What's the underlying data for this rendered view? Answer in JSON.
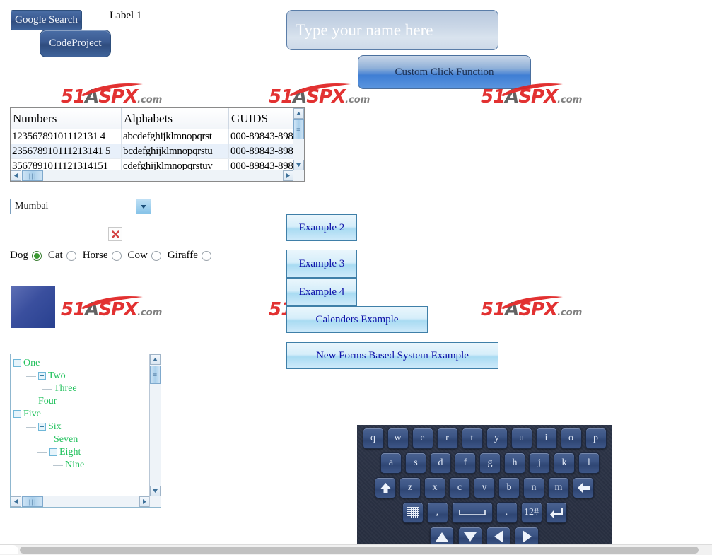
{
  "top": {
    "google_search_label": "Google Search",
    "codeproject_label": "CodeProject",
    "label1": "Label 1",
    "name_input_value": "",
    "name_input_placeholder": "Type your name here",
    "custom_click_label": "Custom Click Function"
  },
  "watermark": {
    "num": "51",
    "a": "A",
    "spx": "SPX",
    "dot": ".com"
  },
  "grid": {
    "columns": [
      "Numbers",
      "Alphabets",
      "GUIDS"
    ],
    "rows": [
      [
        "12356789101112131 4",
        "abcdefghijklmnopqrst",
        "000-89843-898"
      ],
      [
        "235678910111213141 5",
        "bcdefghijklmnopqrstu",
        "000-89843-898"
      ],
      [
        "3567891011121314151",
        "cdefghijklmnopqrstuv",
        "000-89843-898"
      ]
    ]
  },
  "select": {
    "value": "Mumbai",
    "options": [
      "Mumbai"
    ]
  },
  "radios": {
    "items": [
      {
        "label": "Dog",
        "checked": true
      },
      {
        "label": "Cat",
        "checked": false
      },
      {
        "label": "Horse",
        "checked": false
      },
      {
        "label": "Cow",
        "checked": false
      },
      {
        "label": "Giraffe",
        "checked": false
      }
    ]
  },
  "buttons": {
    "example2": "Example 2",
    "example3": "Example 3",
    "example4": "Example 4",
    "calendars": "Calenders Example",
    "newforms": "New Forms Based System Example"
  },
  "tree": {
    "nodes": [
      {
        "label": "One",
        "depth": 0,
        "expander": true
      },
      {
        "label": "Two",
        "depth": 1,
        "expander": true
      },
      {
        "label": "Three",
        "depth": 2,
        "expander": false
      },
      {
        "label": "Four",
        "depth": 1,
        "expander": false
      },
      {
        "label": "Five",
        "depth": 0,
        "expander": true
      },
      {
        "label": "Six",
        "depth": 1,
        "expander": true
      },
      {
        "label": "Seven",
        "depth": 2,
        "expander": false
      },
      {
        "label": "Eight",
        "depth": 2,
        "expander": true
      },
      {
        "label": "Nine",
        "depth": 3,
        "expander": false
      }
    ]
  },
  "keyboard": {
    "row1": [
      "q",
      "w",
      "e",
      "r",
      "t",
      "y",
      "u",
      "i",
      "o",
      "p"
    ],
    "row2": [
      "a",
      "s",
      "d",
      "f",
      "g",
      "h",
      "j",
      "k",
      "l"
    ],
    "row3": [
      "shift",
      "z",
      "x",
      "c",
      "v",
      "b",
      "n",
      "m",
      "backspace"
    ],
    "row4": [
      "keypad",
      ",",
      "space",
      ".",
      "12#",
      "enter"
    ],
    "row5": [
      "up",
      "down",
      "left",
      "right"
    ],
    "labels": {
      "numsym": "12#",
      "comma": ",",
      "period": "."
    }
  },
  "colors": {
    "accent_blue": "#3a5a91",
    "button_light": "#a9dbf2",
    "tree_green": "#23c25e",
    "watermark_red": "#e02020",
    "keyboard_bg": "#262d3e"
  }
}
